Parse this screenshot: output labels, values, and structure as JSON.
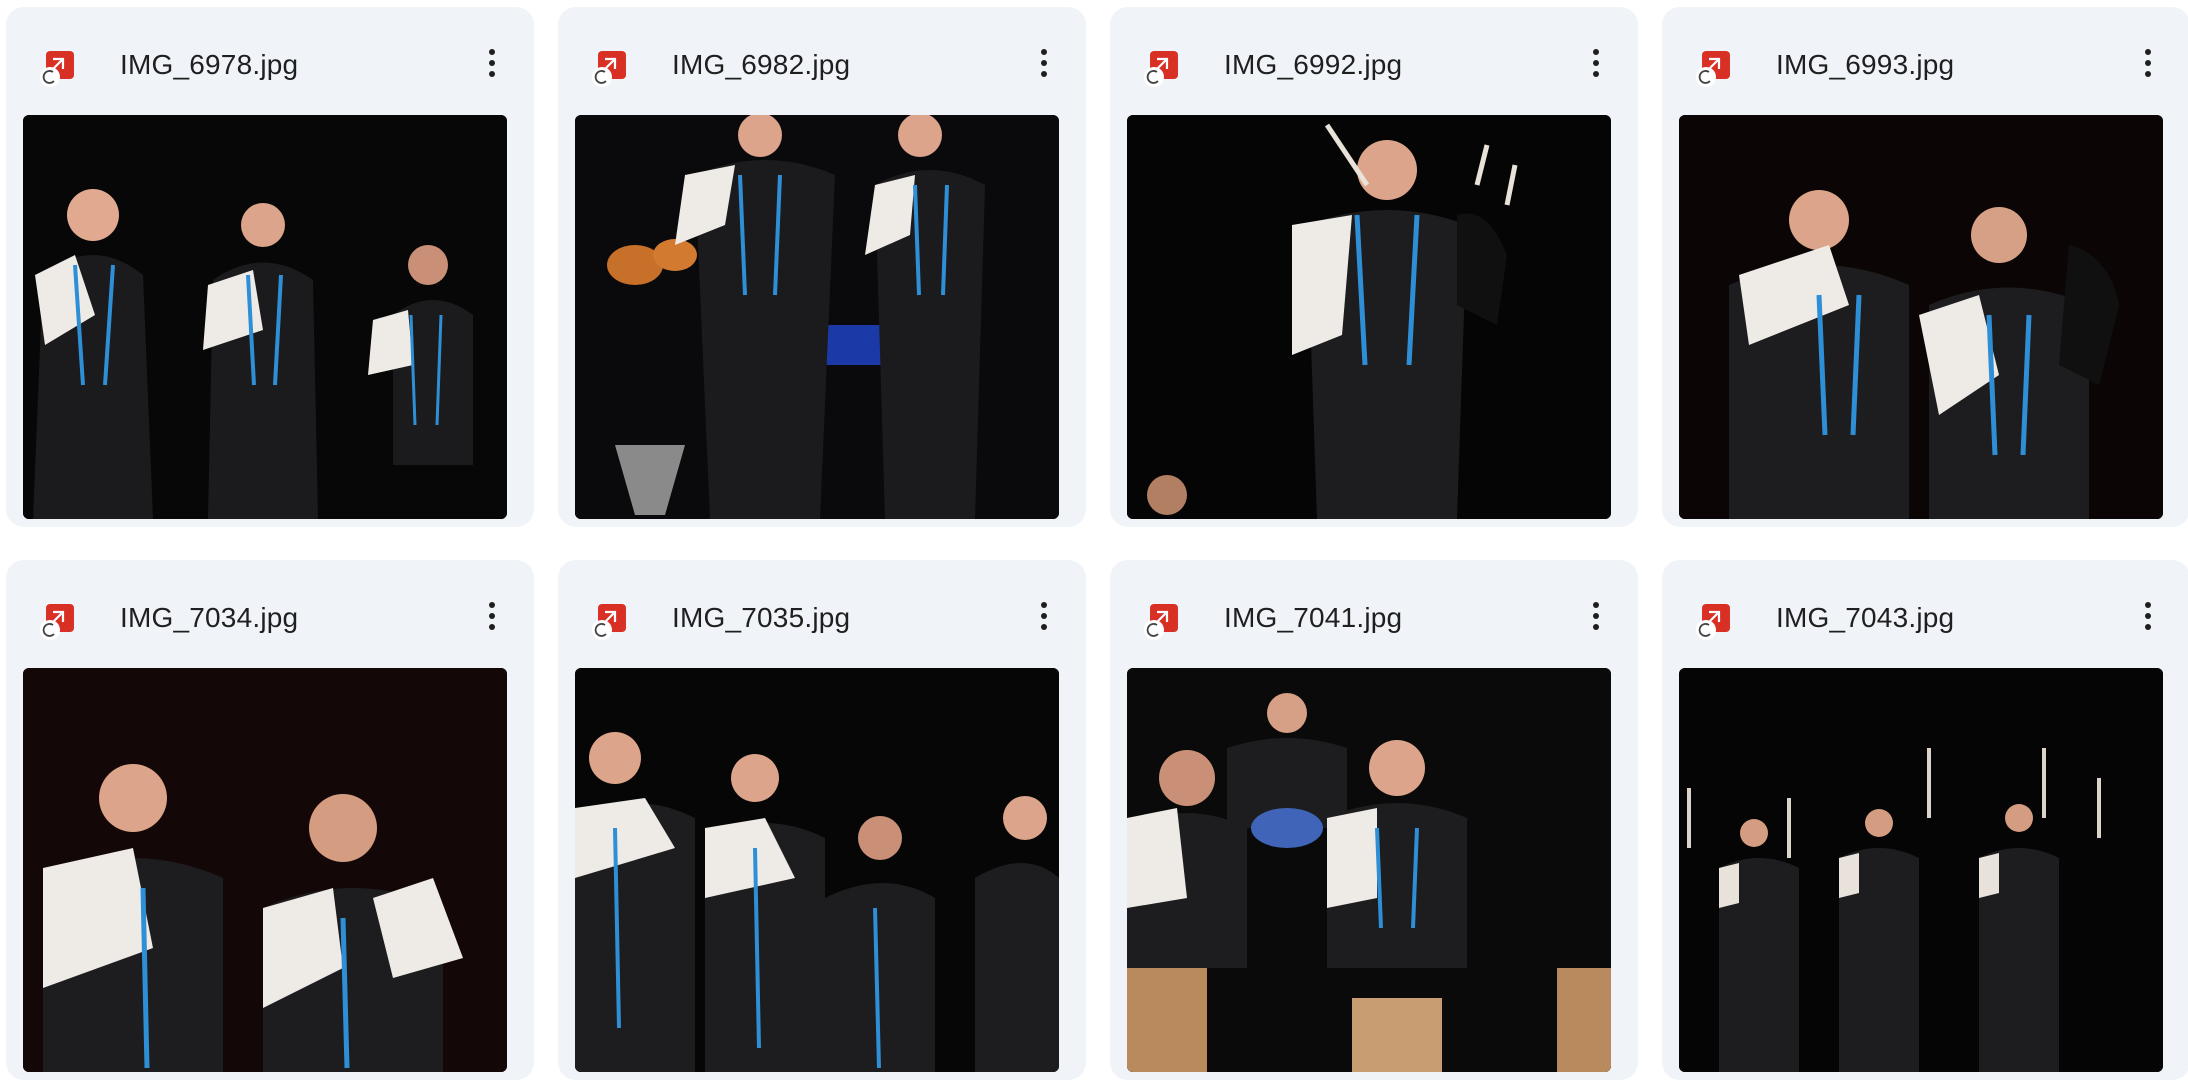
{
  "files": [
    {
      "name": "IMG_6978.jpg",
      "thumbnail": "three white-shirted musicians in black vests with blue trim playing clarinets on a dark stage",
      "bg": "#070707"
    },
    {
      "name": "IMG_6982.jpg",
      "thumbnail": "two musicians playing wind instruments in front of a drum kit",
      "bg": "#0a0a0c"
    },
    {
      "name": "IMG_6992.jpg",
      "thumbnail": "bagpiper in black vest playing on stage",
      "bg": "#050505"
    },
    {
      "name": "IMG_6993.jpg",
      "thumbnail": "two musicians, one playing bombarde and one playing bagpipes",
      "bg": "#0b0605"
    },
    {
      "name": "IMG_7034.jpg",
      "thumbnail": "two musicians playing bombardes face to face",
      "bg": "#140707"
    },
    {
      "name": "IMG_7035.jpg",
      "thumbnail": "row of musicians playing bombardes on stage",
      "bg": "#060606"
    },
    {
      "name": "IMG_7041.jpg",
      "thumbnail": "percussionists playing cajons with drummer behind",
      "bg": "#0a0a0a"
    },
    {
      "name": "IMG_7043.jpg",
      "thumbnail": "group of bagpipers on a dark stage",
      "bg": "#050505"
    }
  ],
  "icons": {
    "file": "image-file-icon",
    "shortcut": "shortcut-arrow-icon",
    "more": "more-vert-icon"
  },
  "colors": {
    "card_bg": "#f0f4f9",
    "icon_red": "#d93025",
    "vest_blue": "#2f8fd6"
  }
}
